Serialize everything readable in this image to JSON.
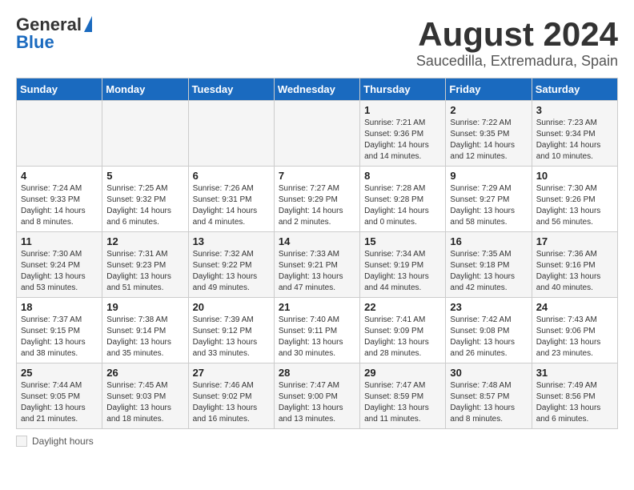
{
  "header": {
    "logo_general": "General",
    "logo_blue": "Blue",
    "month_title": "August 2024",
    "location": "Saucedilla, Extremadura, Spain"
  },
  "days_of_week": [
    "Sunday",
    "Monday",
    "Tuesday",
    "Wednesday",
    "Thursday",
    "Friday",
    "Saturday"
  ],
  "weeks": [
    [
      {
        "day": "",
        "sunrise": "",
        "sunset": "",
        "daylight": ""
      },
      {
        "day": "",
        "sunrise": "",
        "sunset": "",
        "daylight": ""
      },
      {
        "day": "",
        "sunrise": "",
        "sunset": "",
        "daylight": ""
      },
      {
        "day": "",
        "sunrise": "",
        "sunset": "",
        "daylight": ""
      },
      {
        "day": "1",
        "sunrise": "7:21 AM",
        "sunset": "9:36 PM",
        "daylight": "14 hours and 14 minutes."
      },
      {
        "day": "2",
        "sunrise": "7:22 AM",
        "sunset": "9:35 PM",
        "daylight": "14 hours and 12 minutes."
      },
      {
        "day": "3",
        "sunrise": "7:23 AM",
        "sunset": "9:34 PM",
        "daylight": "14 hours and 10 minutes."
      }
    ],
    [
      {
        "day": "4",
        "sunrise": "7:24 AM",
        "sunset": "9:33 PM",
        "daylight": "14 hours and 8 minutes."
      },
      {
        "day": "5",
        "sunrise": "7:25 AM",
        "sunset": "9:32 PM",
        "daylight": "14 hours and 6 minutes."
      },
      {
        "day": "6",
        "sunrise": "7:26 AM",
        "sunset": "9:31 PM",
        "daylight": "14 hours and 4 minutes."
      },
      {
        "day": "7",
        "sunrise": "7:27 AM",
        "sunset": "9:29 PM",
        "daylight": "14 hours and 2 minutes."
      },
      {
        "day": "8",
        "sunrise": "7:28 AM",
        "sunset": "9:28 PM",
        "daylight": "14 hours and 0 minutes."
      },
      {
        "day": "9",
        "sunrise": "7:29 AM",
        "sunset": "9:27 PM",
        "daylight": "13 hours and 58 minutes."
      },
      {
        "day": "10",
        "sunrise": "7:30 AM",
        "sunset": "9:26 PM",
        "daylight": "13 hours and 56 minutes."
      }
    ],
    [
      {
        "day": "11",
        "sunrise": "7:30 AM",
        "sunset": "9:24 PM",
        "daylight": "13 hours and 53 minutes."
      },
      {
        "day": "12",
        "sunrise": "7:31 AM",
        "sunset": "9:23 PM",
        "daylight": "13 hours and 51 minutes."
      },
      {
        "day": "13",
        "sunrise": "7:32 AM",
        "sunset": "9:22 PM",
        "daylight": "13 hours and 49 minutes."
      },
      {
        "day": "14",
        "sunrise": "7:33 AM",
        "sunset": "9:21 PM",
        "daylight": "13 hours and 47 minutes."
      },
      {
        "day": "15",
        "sunrise": "7:34 AM",
        "sunset": "9:19 PM",
        "daylight": "13 hours and 44 minutes."
      },
      {
        "day": "16",
        "sunrise": "7:35 AM",
        "sunset": "9:18 PM",
        "daylight": "13 hours and 42 minutes."
      },
      {
        "day": "17",
        "sunrise": "7:36 AM",
        "sunset": "9:16 PM",
        "daylight": "13 hours and 40 minutes."
      }
    ],
    [
      {
        "day": "18",
        "sunrise": "7:37 AM",
        "sunset": "9:15 PM",
        "daylight": "13 hours and 38 minutes."
      },
      {
        "day": "19",
        "sunrise": "7:38 AM",
        "sunset": "9:14 PM",
        "daylight": "13 hours and 35 minutes."
      },
      {
        "day": "20",
        "sunrise": "7:39 AM",
        "sunset": "9:12 PM",
        "daylight": "13 hours and 33 minutes."
      },
      {
        "day": "21",
        "sunrise": "7:40 AM",
        "sunset": "9:11 PM",
        "daylight": "13 hours and 30 minutes."
      },
      {
        "day": "22",
        "sunrise": "7:41 AM",
        "sunset": "9:09 PM",
        "daylight": "13 hours and 28 minutes."
      },
      {
        "day": "23",
        "sunrise": "7:42 AM",
        "sunset": "9:08 PM",
        "daylight": "13 hours and 26 minutes."
      },
      {
        "day": "24",
        "sunrise": "7:43 AM",
        "sunset": "9:06 PM",
        "daylight": "13 hours and 23 minutes."
      }
    ],
    [
      {
        "day": "25",
        "sunrise": "7:44 AM",
        "sunset": "9:05 PM",
        "daylight": "13 hours and 21 minutes."
      },
      {
        "day": "26",
        "sunrise": "7:45 AM",
        "sunset": "9:03 PM",
        "daylight": "13 hours and 18 minutes."
      },
      {
        "day": "27",
        "sunrise": "7:46 AM",
        "sunset": "9:02 PM",
        "daylight": "13 hours and 16 minutes."
      },
      {
        "day": "28",
        "sunrise": "7:47 AM",
        "sunset": "9:00 PM",
        "daylight": "13 hours and 13 minutes."
      },
      {
        "day": "29",
        "sunrise": "7:47 AM",
        "sunset": "8:59 PM",
        "daylight": "13 hours and 11 minutes."
      },
      {
        "day": "30",
        "sunrise": "7:48 AM",
        "sunset": "8:57 PM",
        "daylight": "13 hours and 8 minutes."
      },
      {
        "day": "31",
        "sunrise": "7:49 AM",
        "sunset": "8:56 PM",
        "daylight": "13 hours and 6 minutes."
      }
    ]
  ],
  "footer": {
    "daylight_label": "Daylight hours"
  }
}
